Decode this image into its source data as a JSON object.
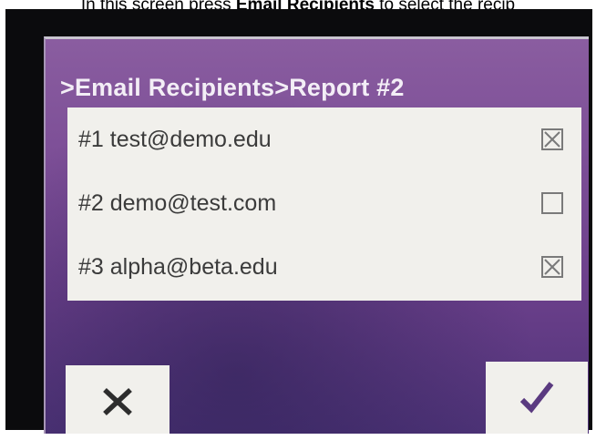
{
  "caption": {
    "prefix": "In this screen press ",
    "emphasis": "Email Recipients",
    "suffix": " to select the recip"
  },
  "header": {
    "title": ">Email Recipients>Report #2"
  },
  "recipients": [
    {
      "label": "#1 test@demo.edu",
      "checked": true
    },
    {
      "label": "#2 demo@test.com",
      "checked": false
    },
    {
      "label": "#3 alpha@beta.edu",
      "checked": true
    }
  ],
  "buttons": {
    "cancel_icon": "close-x-icon",
    "confirm_icon": "checkmark-icon"
  },
  "colors": {
    "screen_top": "#8a5da0",
    "screen_bottom": "#4e3378",
    "panel": "#f1f0ec",
    "icon_dark": "#2d2d2d",
    "icon_purple": "#5a3a80"
  }
}
